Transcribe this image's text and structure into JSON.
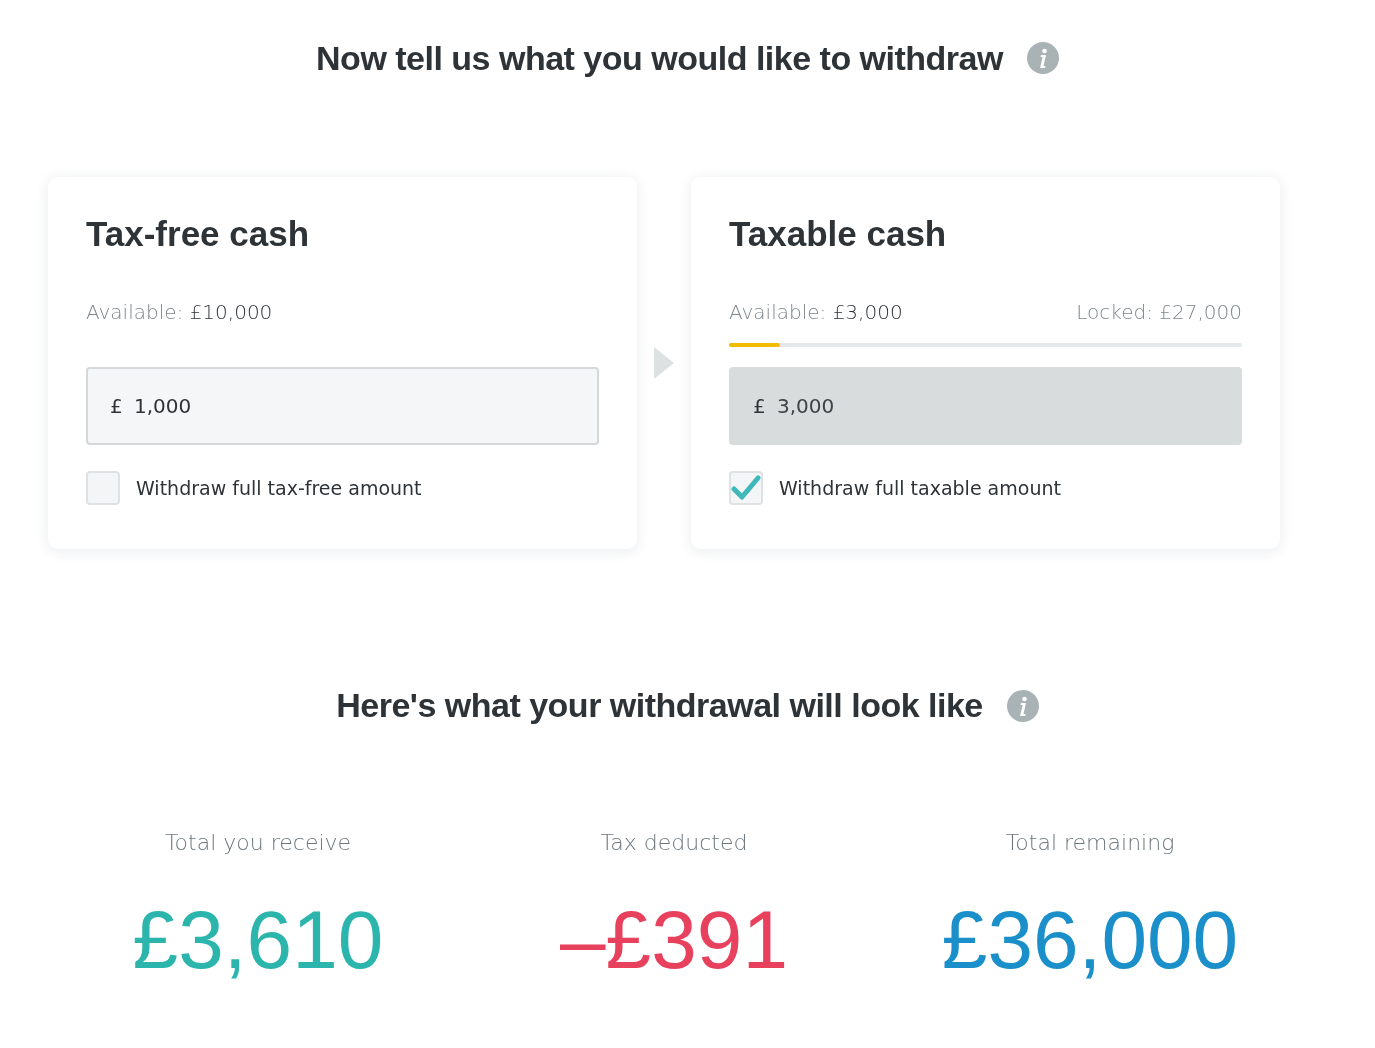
{
  "withdraw_heading": {
    "title": "Now tell us what you would like to withdraw"
  },
  "cards": [
    {
      "title": "Tax-free cash",
      "available": {
        "label": "Available:",
        "amount": "£10,000"
      },
      "currency": "£",
      "value": "1,000",
      "disabled": false,
      "checkbox": {
        "label": "Withdraw full tax-free amount",
        "checked": false
      }
    },
    {
      "title": "Taxable cash",
      "available": {
        "label": "Available:",
        "amount": "£3,000"
      },
      "locked": "Locked: £27,000",
      "level": 0.1,
      "currency": "£",
      "value": "3,000",
      "disabled": true,
      "checkbox": {
        "label": "Withdraw full taxable amount",
        "checked": true
      }
    }
  ],
  "summary_heading": {
    "title": "Here's what your withdrawal will look like"
  },
  "results": [
    {
      "label": "Total you receive",
      "value": "£3,610",
      "color": "#2bb5ad"
    },
    {
      "label": "Tax deducted",
      "value": "–£391",
      "color": "#e8415e"
    },
    {
      "label": "Total remaining",
      "value": "£36,000",
      "color": "#1a8fc9"
    }
  ]
}
